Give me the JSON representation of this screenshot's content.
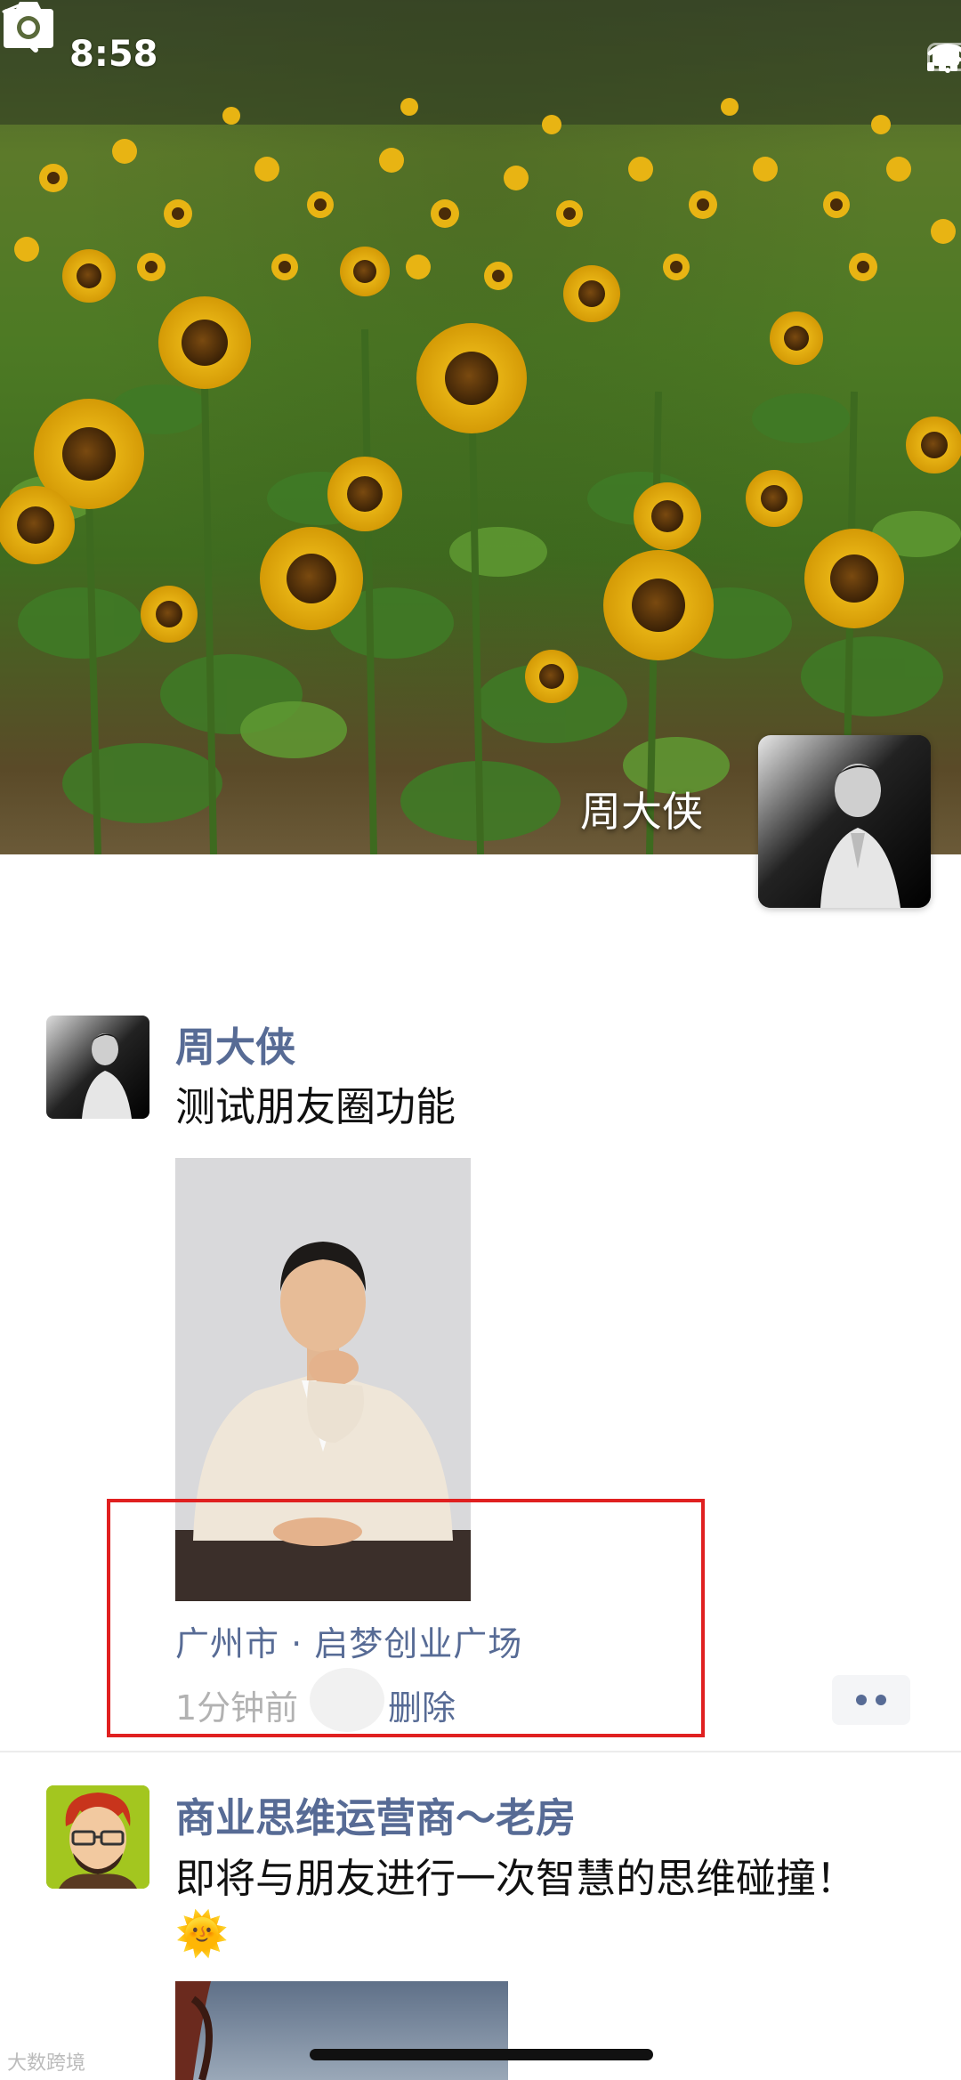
{
  "status_bar": {
    "time": "8:58"
  },
  "cover": {
    "owner_name": "周大侠"
  },
  "posts": [
    {
      "nickname": "周大侠",
      "text": "测试朋友圈功能",
      "location": "广州市 · 启梦创业广场",
      "time_ago": "1分钟前",
      "delete_label": "删除"
    },
    {
      "nickname": "商业思维运营商～老房",
      "text": "即将与朋友进行一次智慧的思维碰撞！",
      "emoji": "🌞"
    }
  ],
  "watermark": "大数跨境",
  "colors": {
    "link": "#576b95",
    "highlight": "#e02020",
    "muted": "#b2b2b2"
  }
}
